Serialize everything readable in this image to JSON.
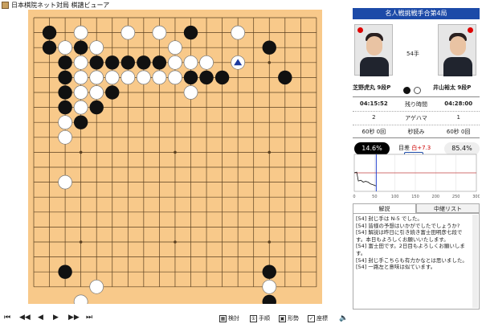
{
  "window": {
    "title": "日本棋院ネット対局 棋譜ビューア"
  },
  "header": {
    "title": "名人戦挑戦手合第4局"
  },
  "players": {
    "move_label": "54手",
    "black_name": "芝野虎丸 9段P",
    "white_name": "井山裕太 9段P"
  },
  "stats": {
    "rows": [
      {
        "left": "04:15:52",
        "mid": "残り時間",
        "right": "04:28:00"
      },
      {
        "left": "2",
        "mid": "アゲハマ",
        "right": "1"
      },
      {
        "left": "60秒 0回",
        "mid": "秒読み",
        "right": "60秒 0回"
      }
    ]
  },
  "win": {
    "black_pct": "14.6%",
    "white_pct": "85.4%",
    "diff_label": "目差",
    "diff_value": "白+7.3",
    "ref_label": "参考図",
    "black_rate": 0.146,
    "white_rate": 0.854
  },
  "graph": {
    "ticks": [
      "0",
      "50",
      "100",
      "150",
      "200",
      "250",
      "300"
    ],
    "current_move": 54
  },
  "tabs": {
    "kaisetsu": "解説",
    "chuukei": "中継リスト"
  },
  "commentary": [
    "[54] 封じ手は N-5 でした。",
    "[54] 皆様の予想はいかがでしたでしょうか?",
    "[54] 解説は昨日に引き続き富士田明彦七段です。本日もよろしくお願いいたします。",
    "[54] 富士田です。2日目もよろしくお願いします。",
    "[54] 封じ手こちらも有力かなとは思いました。",
    "[54] 一路左と意味は似ています。"
  ],
  "controls": {
    "first": "⏮",
    "prev10": "◀◀",
    "prev": "◀",
    "next": "▶",
    "next10": "▶▶",
    "last": "⏭",
    "kentou": "検討",
    "tejun": "手順",
    "keisei": "形勢",
    "zahyou": "座標",
    "sound": "🔈"
  },
  "board": {
    "size": 19,
    "colors": {
      "wood": "#f8c98a",
      "line": "#5a4020"
    },
    "black": [
      [
        1,
        1
      ],
      [
        10,
        1
      ],
      [
        1,
        2
      ],
      [
        3,
        2
      ],
      [
        15,
        2
      ],
      [
        2,
        3
      ],
      [
        4,
        3
      ],
      [
        5,
        3
      ],
      [
        6,
        3
      ],
      [
        7,
        3
      ],
      [
        8,
        3
      ],
      [
        2,
        4
      ],
      [
        10,
        4
      ],
      [
        11,
        4
      ],
      [
        12,
        4
      ],
      [
        16,
        4
      ],
      [
        2,
        5
      ],
      [
        5,
        5
      ],
      [
        2,
        6
      ],
      [
        4,
        6
      ],
      [
        3,
        7
      ],
      [
        2,
        17
      ],
      [
        15,
        17
      ],
      [
        15,
        19
      ]
    ],
    "white": [
      [
        3,
        1
      ],
      [
        6,
        1
      ],
      [
        8,
        1
      ],
      [
        13,
        1
      ],
      [
        2,
        2
      ],
      [
        4,
        2
      ],
      [
        9,
        2
      ],
      [
        3,
        3
      ],
      [
        9,
        3
      ],
      [
        10,
        3
      ],
      [
        11,
        3
      ],
      [
        3,
        4
      ],
      [
        4,
        4
      ],
      [
        5,
        4
      ],
      [
        6,
        4
      ],
      [
        7,
        4
      ],
      [
        8,
        4
      ],
      [
        9,
        4
      ],
      [
        3,
        5
      ],
      [
        4,
        5
      ],
      [
        10,
        5
      ],
      [
        3,
        6
      ],
      [
        2,
        7
      ],
      [
        2,
        8
      ],
      [
        2,
        11
      ],
      [
        4,
        18
      ],
      [
        3,
        19
      ],
      [
        15,
        18
      ]
    ],
    "last_move": [
      13,
      3
    ]
  }
}
